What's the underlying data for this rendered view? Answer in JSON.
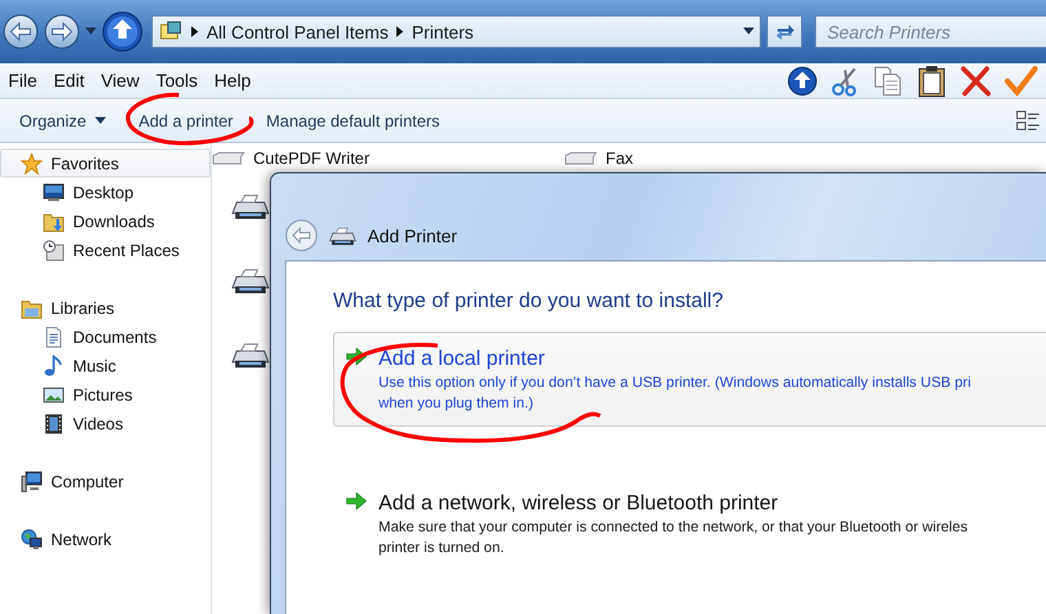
{
  "address_bar": {
    "breadcrumbs": [
      "All Control Panel Items",
      "Printers"
    ]
  },
  "search": {
    "placeholder": "Search Printers"
  },
  "menu_bar": [
    "File",
    "Edit",
    "View",
    "Tools",
    "Help"
  ],
  "toolbar": [
    {
      "label": "Organize",
      "has_menu": true
    },
    {
      "label": "Add a printer",
      "has_menu": false
    },
    {
      "label": "Manage default printers",
      "has_menu": false
    }
  ],
  "navigation_pane": [
    {
      "label": "Favorites",
      "selected": true,
      "children": [
        {
          "label": "Desktop"
        },
        {
          "label": "Downloads"
        },
        {
          "label": "Recent Places"
        }
      ]
    },
    {
      "label": "Libraries",
      "selected": false,
      "children": [
        {
          "label": "Documents"
        },
        {
          "label": "Music"
        },
        {
          "label": "Pictures"
        },
        {
          "label": "Videos"
        }
      ]
    },
    {
      "label": "Computer",
      "selected": false
    },
    {
      "label": "Network",
      "selected": false
    }
  ],
  "printers": [
    {
      "name": "CutePDF Writer"
    },
    {
      "name": "Fax"
    }
  ],
  "dialog": {
    "title": "Add Printer",
    "heading": "What type of printer do you want to install?",
    "options": [
      {
        "title": "Add a local printer",
        "hovered": true,
        "description_lines": [
          "Use this option only if you don’t have a USB printer. (Windows automatically installs USB pri",
          "when you plug them in.)"
        ]
      },
      {
        "title": "Add a network, wireless or Bluetooth printer",
        "hovered": false,
        "description_lines": [
          "Make sure that your computer is connected to the network, or that your Bluetooth or wireles",
          "printer is turned on."
        ]
      }
    ]
  }
}
